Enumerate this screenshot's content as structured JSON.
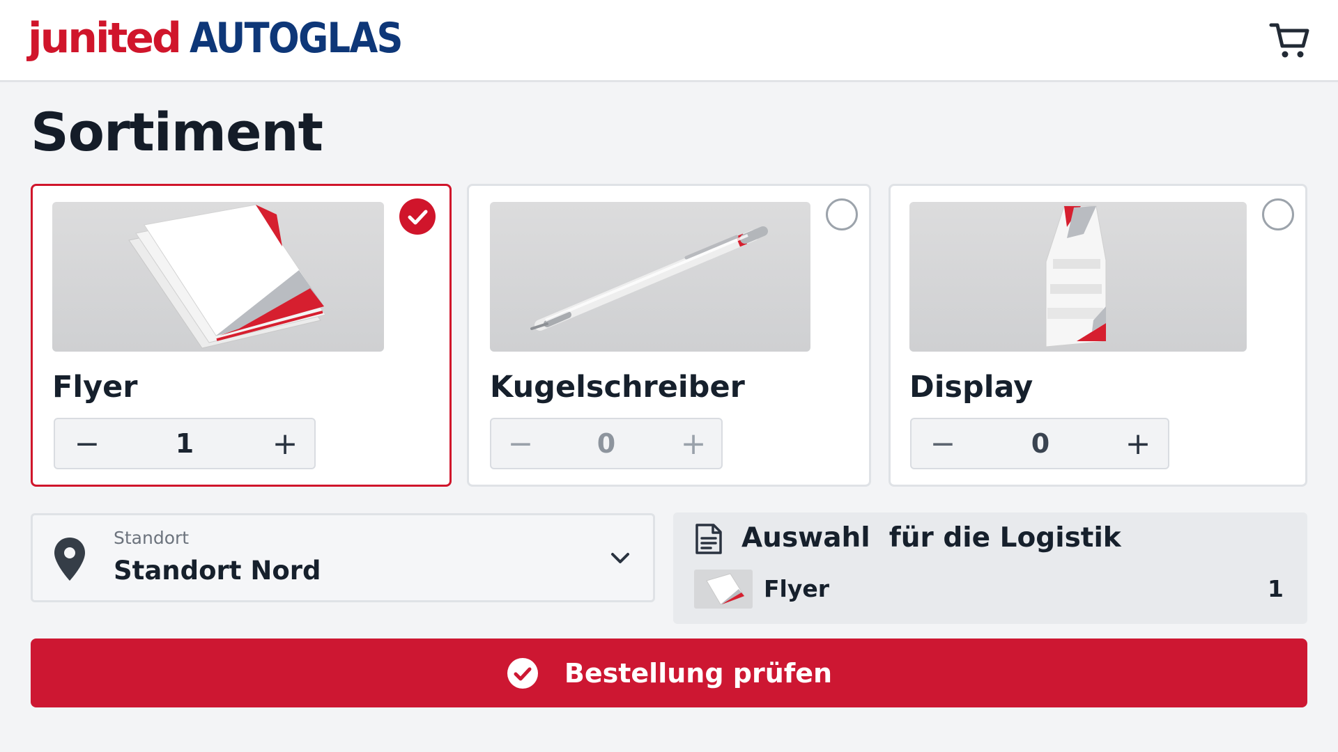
{
  "brand": {
    "name_part1": "junited",
    "name_part2": "AUTOGLAS",
    "color_red": "#d0152b",
    "color_blue": "#0e3778"
  },
  "header": {
    "cart_icon": "shopping-cart-icon"
  },
  "page": {
    "title": "Sortiment"
  },
  "products": [
    {
      "name": "Flyer",
      "quantity": "1",
      "selected": true,
      "image": "flyer-stack-image"
    },
    {
      "name": "Kugelschreiber",
      "quantity": "0",
      "selected": false,
      "image": "pen-image"
    },
    {
      "name": "Display",
      "quantity": "0",
      "selected": false,
      "image": "display-stand-image"
    }
  ],
  "stepper": {
    "minus": "−",
    "plus": "+"
  },
  "location": {
    "label": "Standort",
    "value": "Standort Nord",
    "icon": "map-pin-icon"
  },
  "summary": {
    "title": "Auswahl  für die Logistik",
    "icon": "document-icon",
    "items": [
      {
        "name": "Flyer",
        "quantity": "1"
      }
    ]
  },
  "cta": {
    "label": "Bestellung prüfen",
    "icon": "check-circle-icon",
    "color": "#cd1732"
  }
}
